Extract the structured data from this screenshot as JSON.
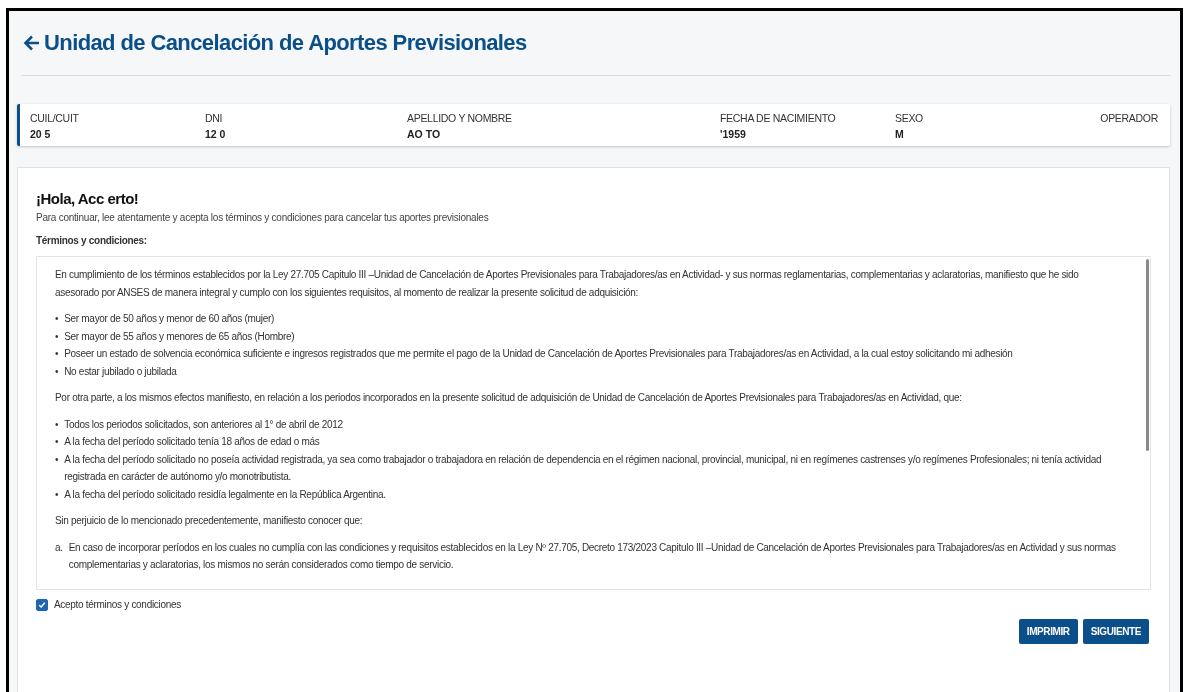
{
  "header": {
    "title": "Unidad de Cancelación de Aportes Previsionales"
  },
  "person_fields": [
    {
      "label": "CUIL/CUIT",
      "value": "20 5"
    },
    {
      "label": "DNI",
      "value": "12 0"
    },
    {
      "label": "APELLIDO Y NOMBRE",
      "value": "AO TO"
    },
    {
      "label": "FECHA DE NACIMIENTO",
      "value": "'1959"
    },
    {
      "label": "SEXO",
      "value": "M"
    },
    {
      "label": "OPERADOR"
    }
  ],
  "greeting": "¡Hola, Acc erto!",
  "intro": "Para continuar, lee atentamente y acepta los términos y condiciones para cancelar tus aportes previsionales",
  "terms_title": "Términos y condiciones:",
  "terms": [
    {
      "kind": "paragraph",
      "text": "En cumplimiento de los términos establecidos por la Ley 27.705 Capitulo III –Unidad de Cancelación de Aportes Previsionales para Trabajadores/as en Actividad- y sus normas reglamentarias, complementarias y aclaratorias, manifiesto que he sido asesorado por ANSES de manera integral y cumplo con los siguientes requisitos, al momento de realizar la presente solicitud de adquisición:"
    },
    {
      "kind": "list",
      "items": [
        {
          "marker": "•",
          "text": "Ser mayor de 50 años y menor de 60 años (mujer)"
        },
        {
          "marker": "•",
          "text": "Ser mayor de 55 años y menores de 65 años (Hombre)"
        },
        {
          "marker": "•",
          "text": "Poseer un estado de solvencia económica suficiente e ingresos registrados que me permite el pago de la Unidad de Cancelación de Aportes Previsionales para Trabajadores/as en Actividad, a la cual estoy solicitando mi adhesión"
        },
        {
          "marker": "•",
          "text": "No estar jubilado o jubilada"
        }
      ]
    },
    {
      "kind": "paragraph",
      "text": "Por otra parte, a los mismos efectos manifiesto, en relación a los periodos incorporados en la presente solicitud de adquisición de Unidad de Cancelación de Aportes Previsionales para Trabajadores/as en Actividad, que:"
    },
    {
      "kind": "list",
      "items": [
        {
          "marker": "•",
          "text": "Todos los periodos solicitados, son anteriores al 1° de abril de 2012"
        },
        {
          "marker": "•",
          "text": "A la fecha del período solicitado tenía 18 años de edad o más"
        },
        {
          "marker": "•",
          "text": "A la fecha del período solicitado no poseía actividad registrada, ya sea como trabajador o trabajadora en relación de dependencia en el régimen nacional, provincial, municipal, ni en regímenes castrenses y/o regímenes Profesionales; ni tenía actividad registrada en carácter de autónomo y/o monotributista."
        },
        {
          "marker": "•",
          "text": "A la fecha del período solicitado residía legalmente en la República Argentina."
        }
      ]
    },
    {
      "kind": "paragraph",
      "text": "Sin perjuicio de lo mencionado precedentemente, manifiesto conocer que:"
    },
    {
      "kind": "list",
      "items": [
        {
          "marker": "a.",
          "text": "En caso de incorporar períodos en los cuales no cumplía con las condiciones y requisitos establecidos en la Ley Nº 27.705, Decreto 173/2023 Capitulo III –Unidad de Cancelación de Aportes Previsionales para Trabajadores/as en Actividad y sus normas complementarias y aclaratorias, los mismos no serán considerados como tiempo de servicio."
        }
      ]
    }
  ],
  "accept": {
    "label": "Acepto términos y condiciones",
    "checked": true
  },
  "buttons": [
    "IMPRIMIR",
    "SIGUIENTE"
  ]
}
